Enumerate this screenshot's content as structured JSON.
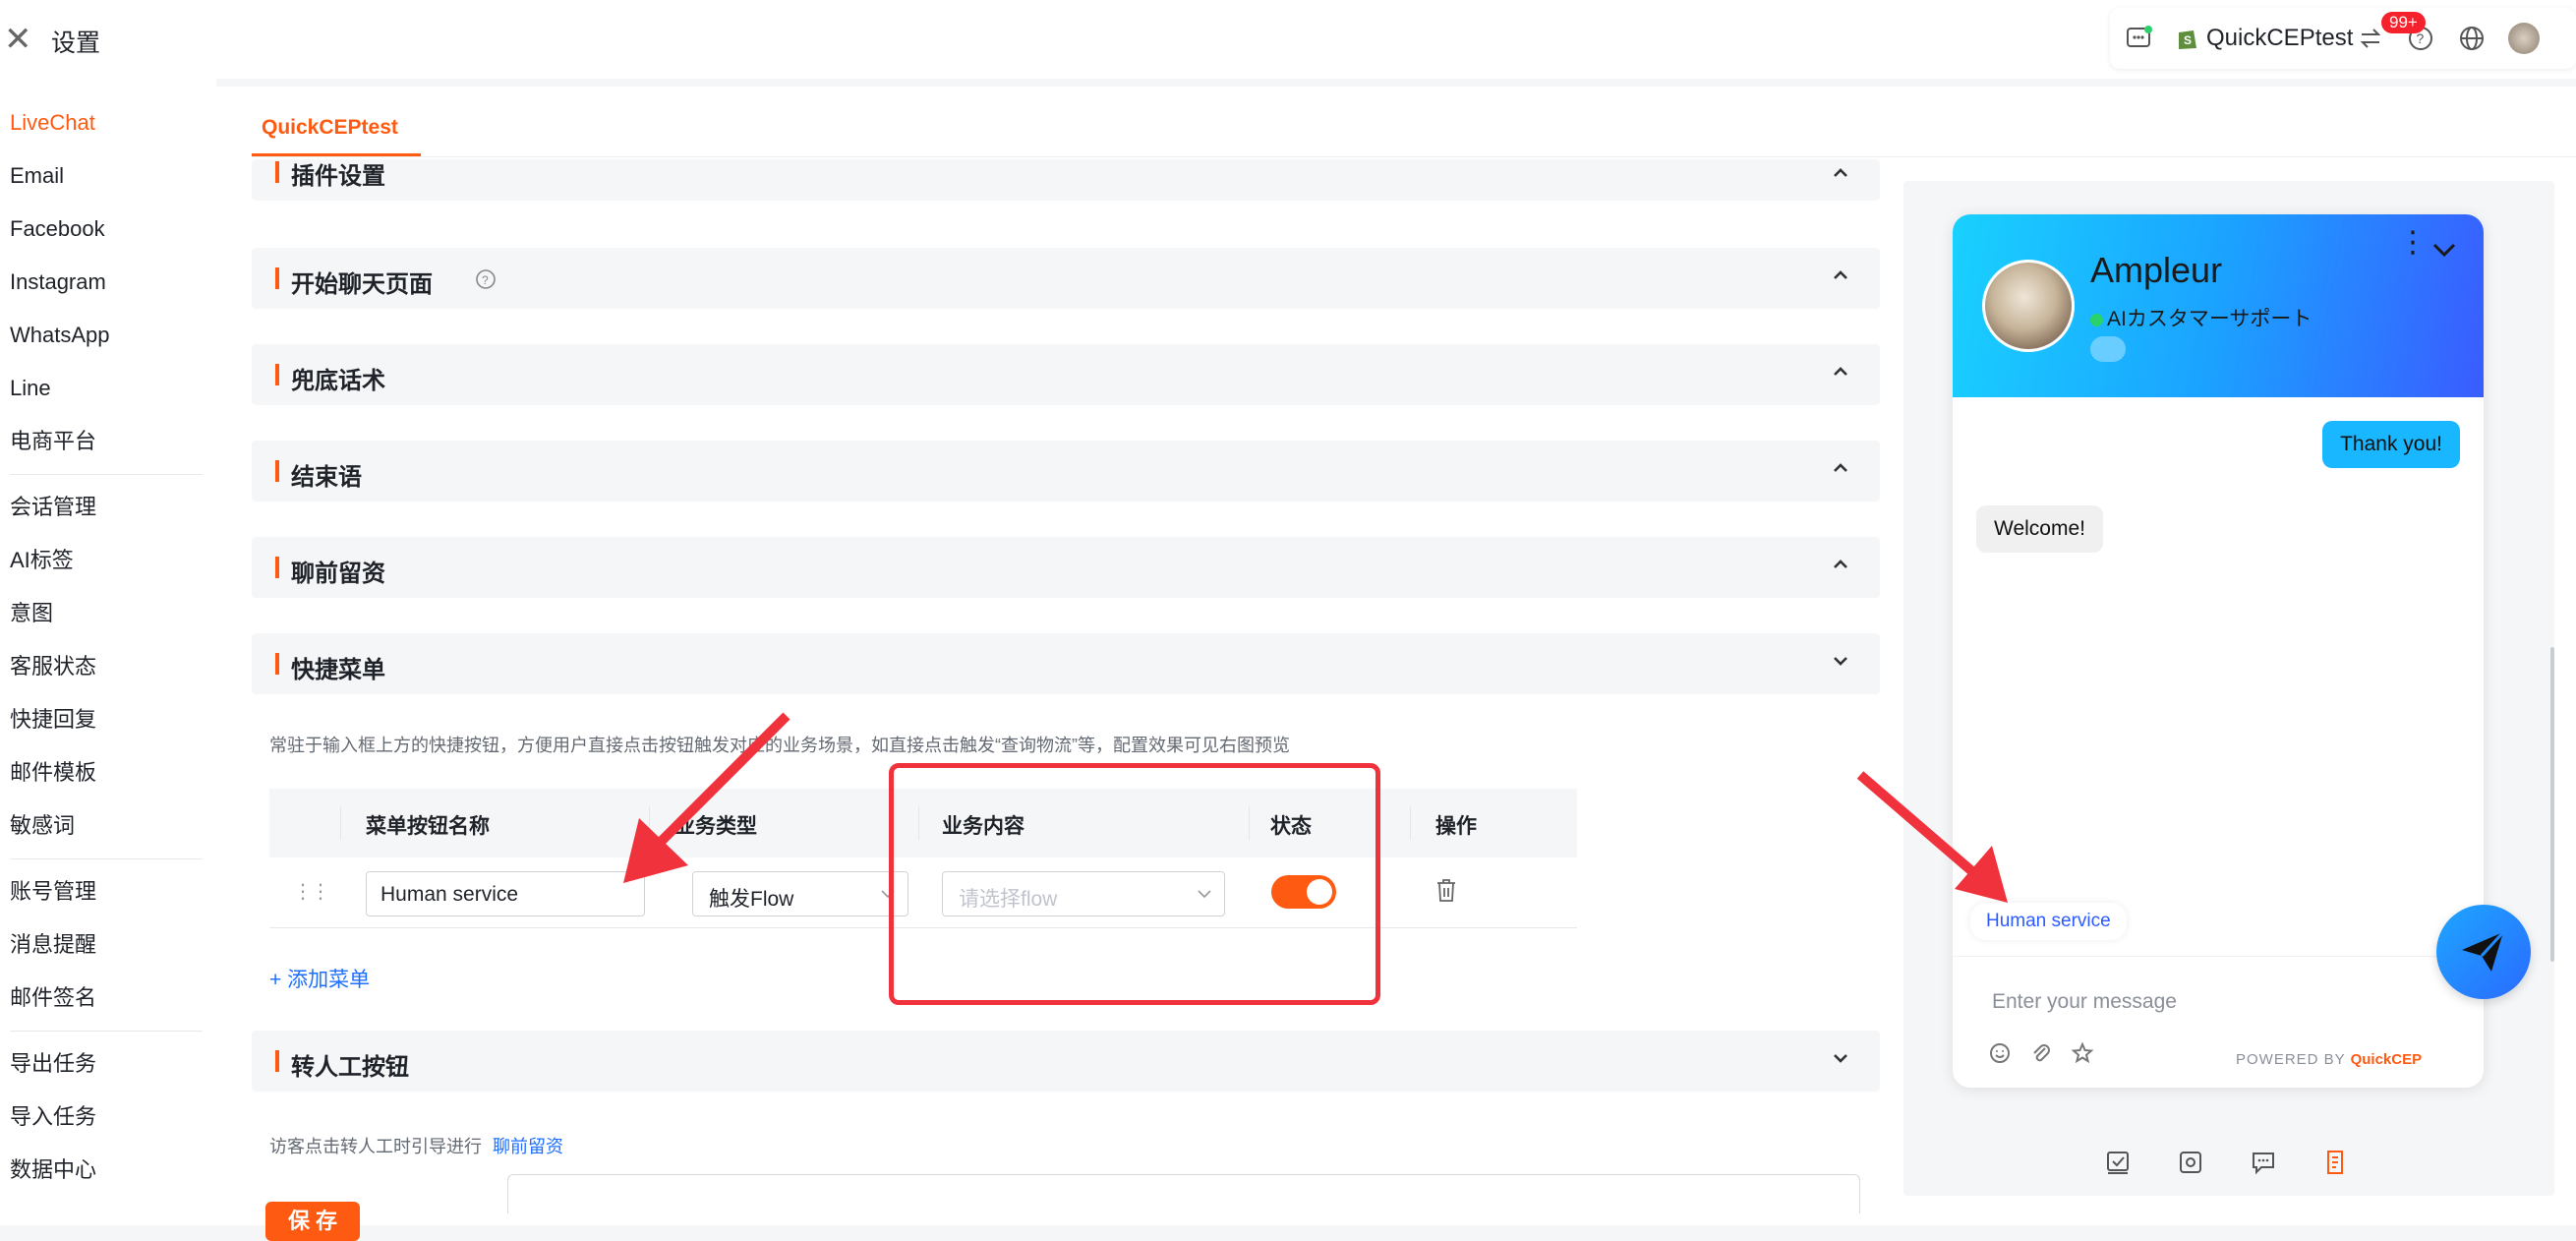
{
  "app": {
    "title": "设置"
  },
  "header": {
    "store_name": "QuickCEPtest",
    "badge": "99+",
    "icons": [
      "chat-icon",
      "shopify-icon",
      "switch-icon",
      "help-icon",
      "globe-icon",
      "avatar"
    ]
  },
  "sidebar": {
    "groups": [
      [
        {
          "label": "LiveChat",
          "active": true
        },
        {
          "label": "Email"
        },
        {
          "label": "Facebook"
        },
        {
          "label": "Instagram"
        },
        {
          "label": "WhatsApp"
        },
        {
          "label": "Line"
        },
        {
          "label": "电商平台"
        }
      ],
      [
        {
          "label": "会话管理"
        },
        {
          "label": "AI标签"
        },
        {
          "label": "意图"
        },
        {
          "label": "客服状态"
        },
        {
          "label": "快捷回复"
        },
        {
          "label": "邮件模板"
        },
        {
          "label": "敏感词"
        }
      ],
      [
        {
          "label": "账号管理"
        },
        {
          "label": "消息提醒"
        },
        {
          "label": "邮件签名"
        }
      ],
      [
        {
          "label": "导出任务"
        },
        {
          "label": "导入任务"
        },
        {
          "label": "数据中心"
        }
      ]
    ]
  },
  "main": {
    "tab": "QuickCEPtest",
    "sections": [
      {
        "title": "插件设置",
        "expanded": false
      },
      {
        "title": "开始聊天页面",
        "expanded": false
      },
      {
        "title": "兜底话术",
        "expanded": false
      },
      {
        "title": "结束语",
        "expanded": false
      },
      {
        "title": "聊前留资",
        "expanded": false
      },
      {
        "title": "快捷菜单",
        "expanded": true
      },
      {
        "title": "转人工按钮",
        "expanded": true
      }
    ],
    "quick_menu": {
      "description": "常驻于输入框上方的快捷按钮，方便用户直接点击按钮触发对应的业务场景，如直接点击触发“查询物流”等，配置效果可见右图预览",
      "columns": [
        "菜单按钮名称",
        "业务类型",
        "业务内容",
        "状态",
        "操作"
      ],
      "rows": [
        {
          "name": "Human service",
          "type": "触发Flow",
          "content_placeholder": "请选择flow",
          "enabled": true
        }
      ],
      "add_label": "+ 添加菜单"
    },
    "transfer": {
      "hint": "访客点击转人工时引导进行",
      "hint_link": "聊前留资"
    },
    "save_label": "保 存"
  },
  "preview": {
    "brand": "Ampleur",
    "status": "AIカスタマーサポート",
    "messages": [
      {
        "from": "user",
        "text": "Thank you!"
      },
      {
        "from": "agent",
        "text": "Welcome!"
      }
    ],
    "quick_button": "Human service",
    "input_placeholder": "Enter your message",
    "powered_by": "POWERED BY",
    "powered_brand": "QuickCEP",
    "colors": {
      "accent": "#ff5a12",
      "header_start": "#19d1ff",
      "header_end": "#3a5cff",
      "link": "#1e6fff"
    }
  }
}
